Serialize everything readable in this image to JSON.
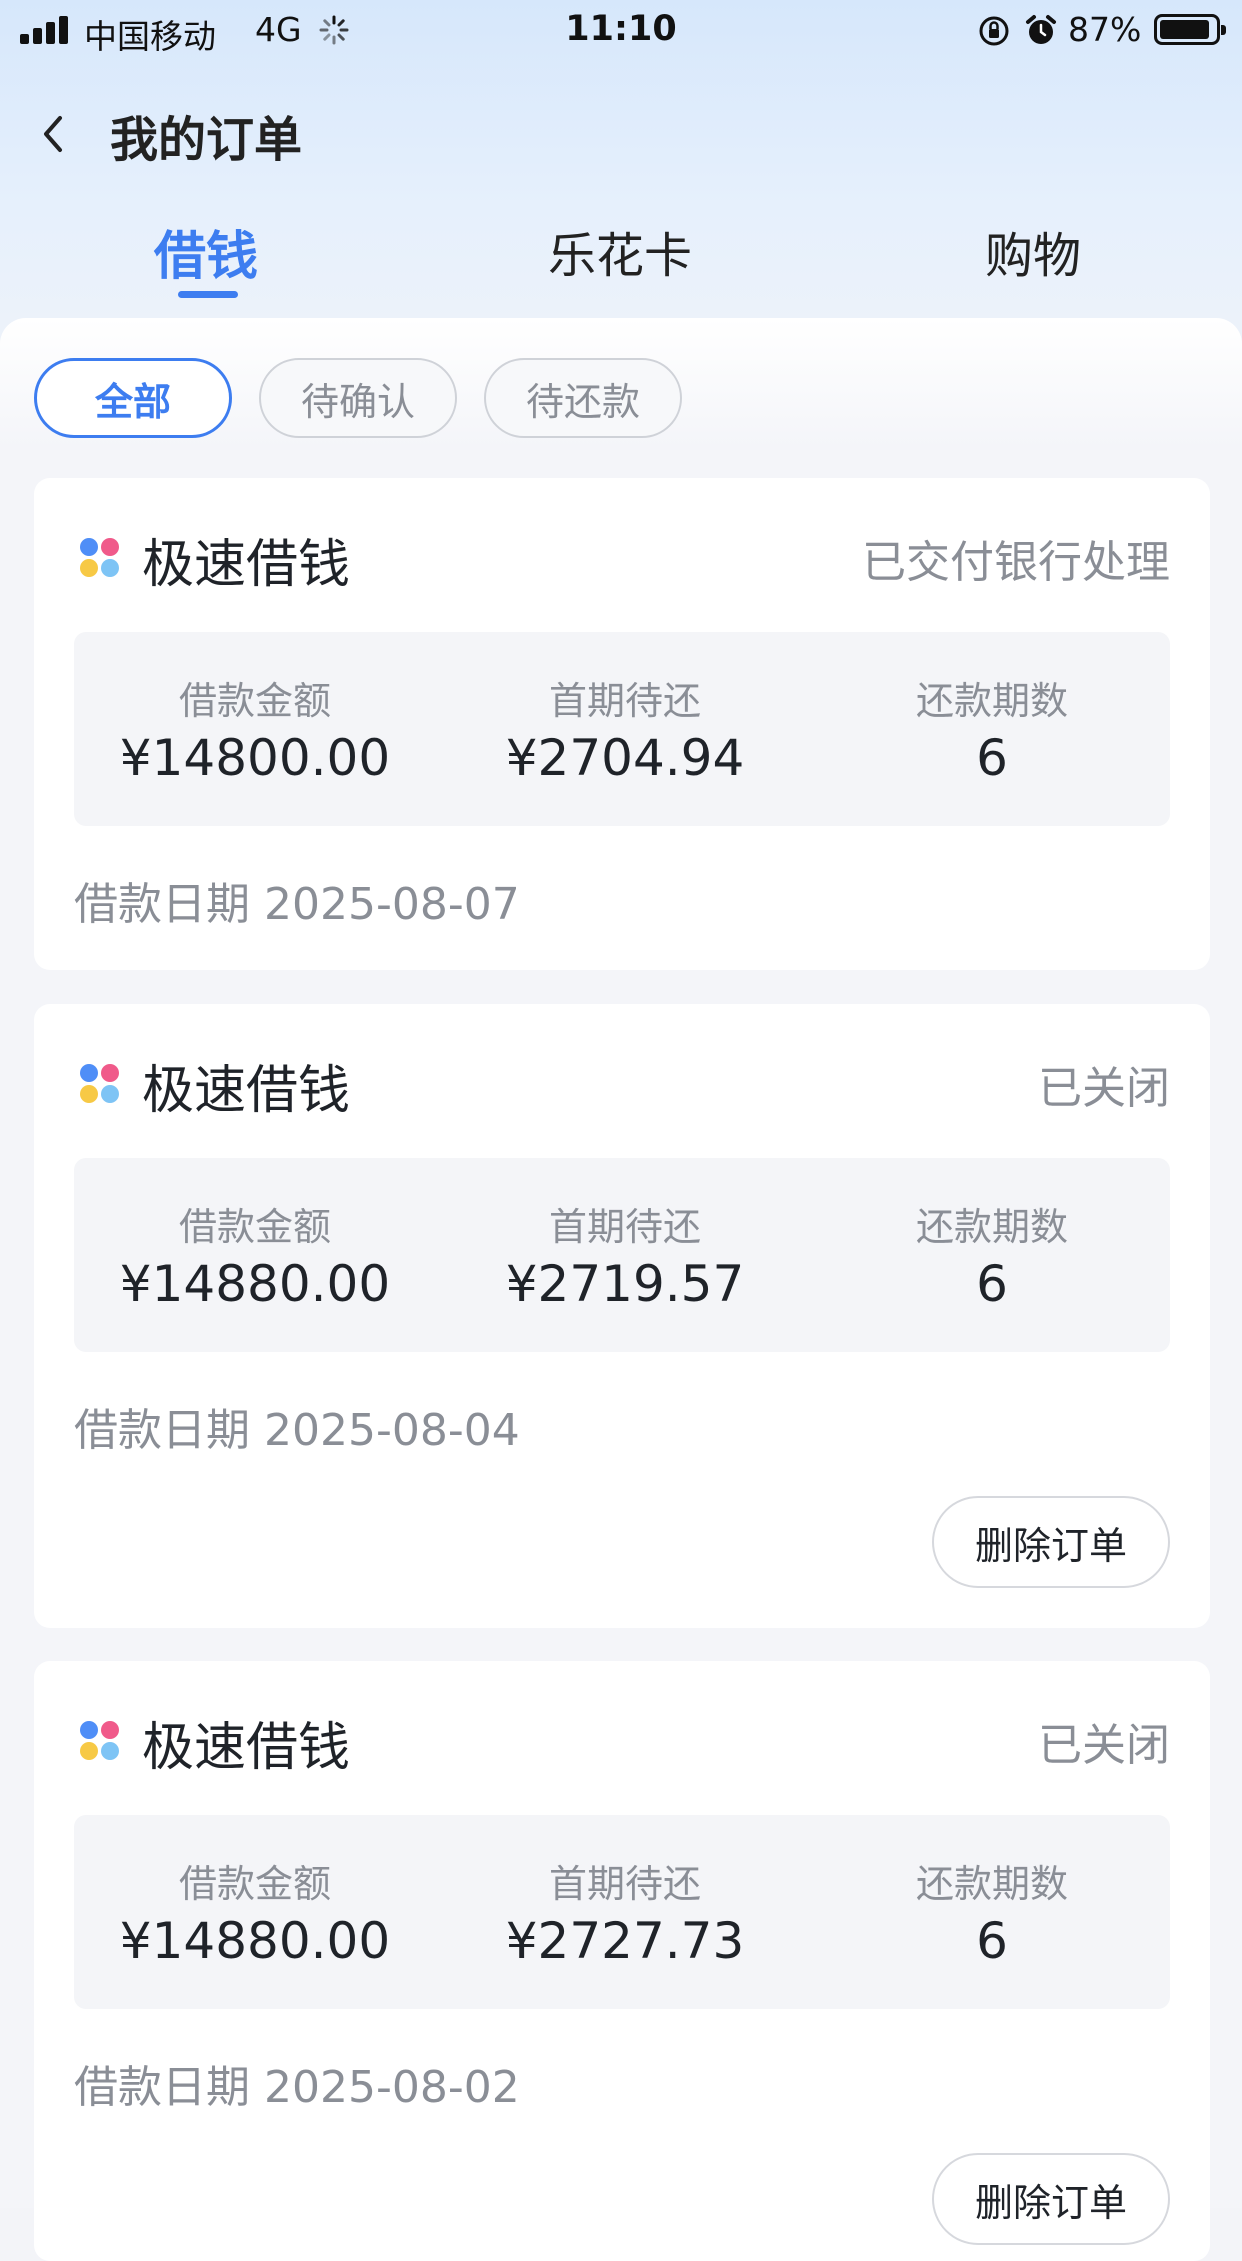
{
  "status_bar": {
    "carrier": "中国移动",
    "network": "4G",
    "time": "11:10",
    "battery": "87%",
    "battery_level": 0.87
  },
  "header": {
    "back_icon": "chevron-left-icon",
    "title": "我的订单"
  },
  "tabs": [
    {
      "label": "借钱",
      "active": true
    },
    {
      "label": "乐花卡",
      "active": false
    },
    {
      "label": "购物",
      "active": false
    }
  ],
  "filters": [
    {
      "label": "全部",
      "active": true
    },
    {
      "label": "待确认",
      "active": false
    },
    {
      "label": "待还款",
      "active": false
    }
  ],
  "colors": {
    "accent": "#3d7df0",
    "muted_text": "#8a8e96",
    "brand_dots": [
      "#4f8ef7",
      "#f05a8a",
      "#f7c945",
      "#7ec4f5"
    ]
  },
  "orders": [
    {
      "product": "极速借钱",
      "status": "已交付银行处理",
      "amount_label": "借款金额",
      "amount": "¥14800.00",
      "first_label": "首期待还",
      "first": "¥2704.94",
      "periods_label": "还款期数",
      "periods": "6",
      "date_label": "借款日期",
      "date": "2025-08-07"
    },
    {
      "product": "极速借钱",
      "status": "已关闭",
      "amount_label": "借款金额",
      "amount": "¥14880.00",
      "first_label": "首期待还",
      "first": "¥2719.57",
      "periods_label": "还款期数",
      "periods": "6",
      "date_label": "借款日期",
      "date": "2025-08-04",
      "action": "删除订单"
    },
    {
      "product": "极速借钱",
      "status": "已关闭",
      "amount_label": "借款金额",
      "amount": "¥14880.00",
      "first_label": "首期待还",
      "first": "¥2727.73",
      "periods_label": "还款期数",
      "periods": "6",
      "date_label": "借款日期",
      "date": "2025-08-02",
      "action": "删除订单"
    }
  ]
}
